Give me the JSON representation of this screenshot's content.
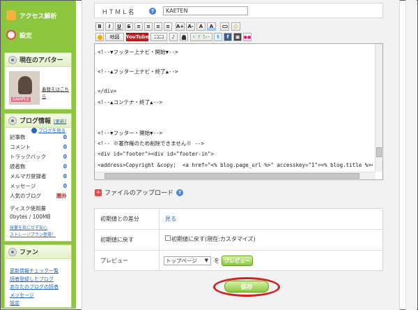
{
  "sidebar": {
    "nav": [
      {
        "label": "アクセス解析",
        "icon": "access-analysis-icon",
        "color": "#f6b23c"
      },
      {
        "label": "設定",
        "icon": "settings-icon",
        "color": "#e9473e"
      }
    ],
    "avatar_panel": {
      "title": "現在のアバター",
      "change_link": "着替えはこちら",
      "avatar_badge": "SAMPLE"
    },
    "blog_info": {
      "title": "ブログ情報",
      "update_link": "[更新]",
      "view_blog_link": "ブログを見る",
      "stats": [
        {
          "label": "記事数",
          "value": "0"
        },
        {
          "label": "コメント",
          "value": "0"
        },
        {
          "label": "トラックバック",
          "value": "0"
        },
        {
          "label": "読者数",
          "value": "0"
        },
        {
          "label": "メルマガ登録者",
          "value": "0"
        },
        {
          "label": "メッセージ",
          "value": "0"
        },
        {
          "label": "人気のブログ",
          "value": "圏外"
        }
      ],
      "disk_title": "ディスク使用量",
      "disk_value": "0bytes / 100MB",
      "disk_link_1": "容量を気にせず安心",
      "disk_link_2": "ストレージプラン登場！"
    },
    "fans_panel": {
      "title": "ファン",
      "links": [
        "更新情報チェック一覧",
        "読者登録したブログ",
        "あなたのブログの読者",
        "メッセージ",
        "設定"
      ]
    }
  },
  "form": {
    "html_name_label": "ＨＴＭＬ名",
    "html_name_value": "KAETEN",
    "help_icon_char": "?",
    "toolbar_row1": [
      "B",
      "I",
      "U",
      "S",
      "≡",
      "≡",
      "≡",
      "≡",
      "A+",
      "A-",
      "A",
      "A",
      "☺"
    ],
    "toolbar_row2": [
      "地図",
      "YouTube",
      "ﾆｺﾆｺ",
      "♪",
      "ﾍﾟｸﾞｳｨｰ",
      "t",
      "f",
      "▣",
      "●●"
    ],
    "code_lines": [
      "<!--▼フッター上ナビ・開始▼-->",
      "",
      "<!--▲フッター上ナビ・終了▲-->",
      "",
      "</div>",
      "<!--▲コンテナ・終了▲-->",
      "",
      "",
      "<!--▼フッター・開始▼-->",
      "<!-- ※著作権のため削除できません※ -->",
      "<div id=\"footer\"><div id=\"footer-in\">",
      "<address>Copyright &copy;  <a href=\"<% blog.page_url %>\" accesskey=\"1\"><% blog.title %></a>"
    ],
    "file_upload_label": "ファイルのアップロード",
    "rows": {
      "diff_label": "初期値との差分",
      "diff_link": "見る",
      "reset_label": "初期値に戻す",
      "reset_checkbox_label": "初期値に戻す(現在:カスタマイズ)",
      "preview_label": "プレビュー",
      "preview_select": "トップページ",
      "preview_to": "を",
      "preview_button": "プレビュー"
    },
    "save_button": "保存"
  }
}
